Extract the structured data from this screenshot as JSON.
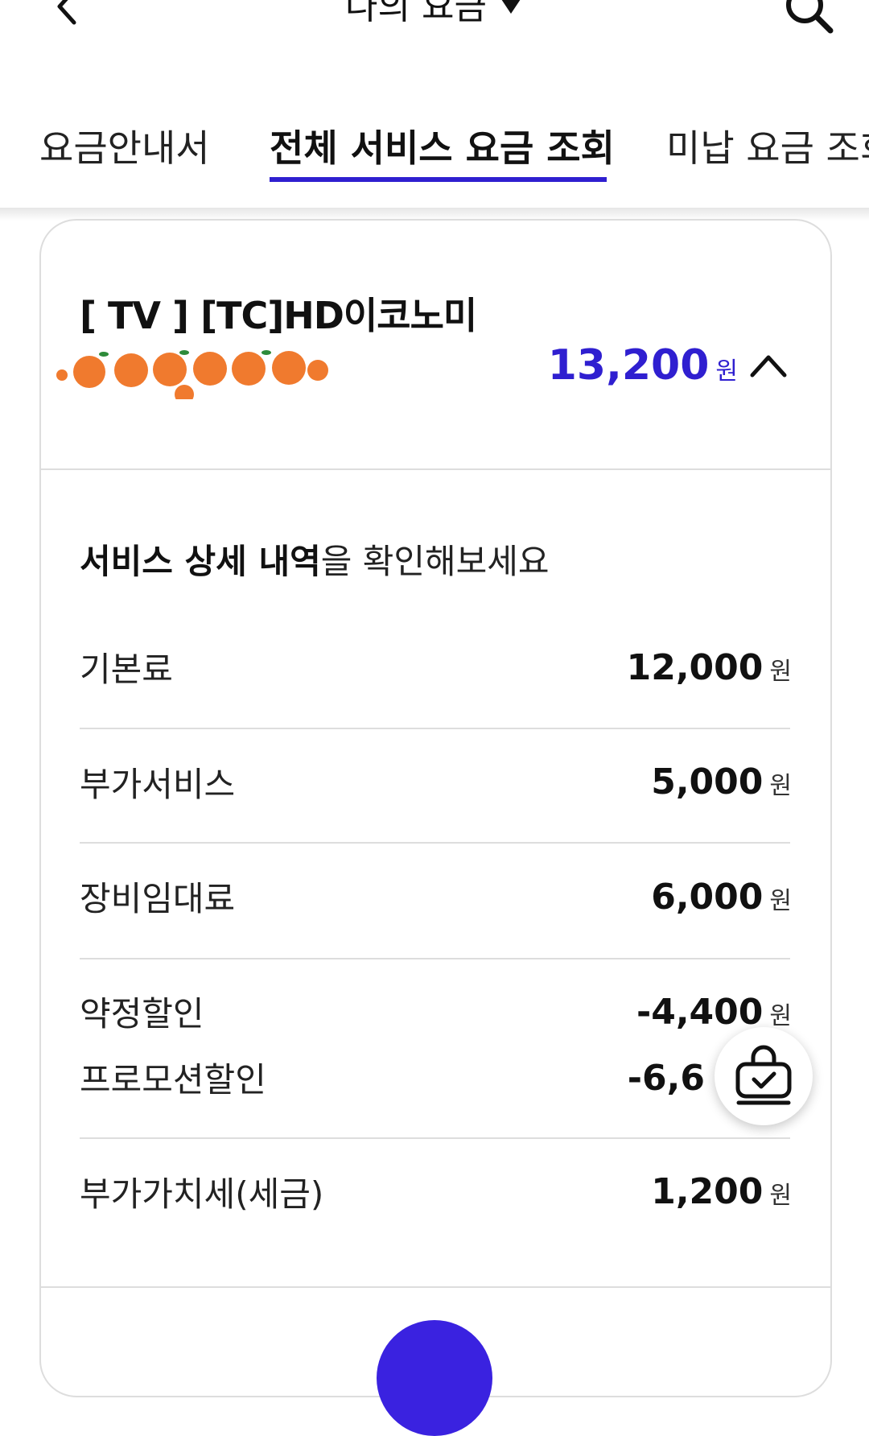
{
  "header": {
    "title": "나의 요금",
    "back_icon": "chevron-left-icon",
    "search_icon": "search-icon"
  },
  "tabs": [
    {
      "label": "요금안내서",
      "active": false
    },
    {
      "label": "전체 서비스 요금 조회",
      "active": true
    },
    {
      "label": "미납 요금 조회",
      "active": false
    }
  ],
  "service": {
    "title": "[ TV ] [TC]HD이코노미",
    "total_amount": "13,200",
    "unit": "원",
    "expanded": true
  },
  "details": {
    "heading_bold": "서비스 상세 내역",
    "heading_rest": "을 확인해보세요",
    "rows": [
      {
        "label": "기본료",
        "amount": "12,000",
        "unit": "원"
      },
      {
        "label": "부가서비스",
        "amount": "5,000",
        "unit": "원"
      },
      {
        "label": "장비임대료",
        "amount": "6,000",
        "unit": "원"
      },
      {
        "label": "약정할인",
        "amount": "-4,400",
        "unit": "원"
      },
      {
        "label": "프로모션할인",
        "amount": "-6,6",
        "unit": ""
      },
      {
        "label": "부가가치세(세금)",
        "amount": "1,200",
        "unit": "원"
      }
    ]
  },
  "colors": {
    "accent": "#2f1fd0",
    "divider": "#dddddd",
    "mask_orange": "#f07a2e"
  },
  "floating": {
    "icon": "shopping-bag-check-icon"
  }
}
